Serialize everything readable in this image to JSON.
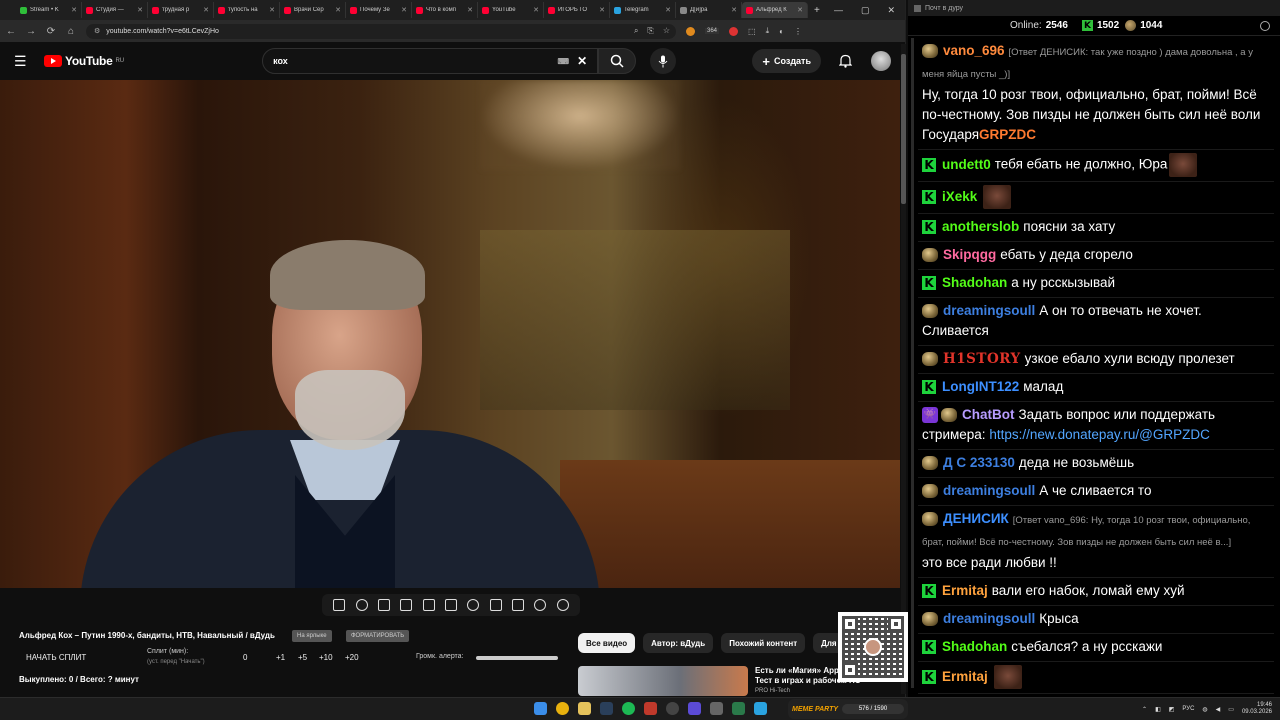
{
  "browser": {
    "tabs": [
      {
        "label": "Stream • K",
        "color": "#2fbf3a"
      },
      {
        "label": "Студия — ",
        "color": "#ff0033"
      },
      {
        "label": "трудная р",
        "color": "#ff0033"
      },
      {
        "label": "тупость на",
        "color": "#ff0033"
      },
      {
        "label": "Врачи Сер",
        "color": "#ff0033"
      },
      {
        "label": "Почему Зе",
        "color": "#ff0033"
      },
      {
        "label": "Что в комп",
        "color": "#ff0033"
      },
      {
        "label": "YouTube",
        "color": "#ff0033"
      },
      {
        "label": "ИГОРЬ ГО",
        "color": "#ff0033"
      },
      {
        "label": "Telegram",
        "color": "#2aa3e0"
      },
      {
        "label": "Д[и]ра",
        "color": "#888888"
      },
      {
        "label": "Альфред К",
        "color": "#ff0033",
        "active": true
      }
    ],
    "new_tab": "+",
    "url": "youtube.com/watch?v=e6tLCevZjHo",
    "ext_count": "364"
  },
  "youtube": {
    "logo_text": "YouTube",
    "logo_region": "RU",
    "search_value": "кох",
    "create_label": "Создать",
    "video_title": "Альфред Кох – Путин 1990-х, бандиты, НТВ, Навальный / вДудь",
    "chip_a": "На ярлыке",
    "chip_b": "ФОРМАТИРОВАТЬ",
    "split": {
      "start_label": "НАЧАТЬ СПЛИТ",
      "split_label": "Сплит (мин):",
      "split_sub": "(уст. перед \"Начать\")",
      "values": [
        "0",
        "+1",
        "+5",
        "+10",
        "+20"
      ],
      "alert_label": "Громк. алерта:",
      "alert_volume": 1.0
    },
    "bought": "Выкуплено: 0 / Всего: ? минут",
    "rec_tabs": [
      "Все видео",
      "Автор: вДудь",
      "Похожий контент",
      "Для в"
    ],
    "rec_item": {
      "title": "Есть ли «Магия» Apple? Тест в играх и рабочем ПО",
      "sub": "PRO Hi-Tech"
    }
  },
  "chat": {
    "window_title": "Почт в дуру",
    "online_label": "Online:",
    "online_count": "2546",
    "kick_count": "1502",
    "twitch_count": "1044",
    "messages": [
      {
        "platform": "twitch",
        "nick": "vano_696",
        "color": "#ff8a3d",
        "reply": "[Ответ ДЕНИСИК: так уже поздно ) дама довольна , а у меня яйца пусты _)]",
        "text": "Ну, тогда 10 розг твои, официально, брат, пойми! Всё по-честному. Зов пизды не должен быть сил неё воли Государя",
        "tail": "GRPZDC"
      },
      {
        "platform": "kick",
        "nick": "undett0",
        "color": "#53fc18",
        "text": "тебя ебать не должно, Юра",
        "emote": true
      },
      {
        "platform": "kick",
        "nick": "iXekk",
        "color": "#53fc18",
        "text": "",
        "emote": true
      },
      {
        "platform": "kick",
        "nick": "anotherslob",
        "color": "#53fc18",
        "text": "поясни за хату"
      },
      {
        "platform": "twitch",
        "nick": "Skipqgg",
        "color": "#ff6aa0",
        "text": "ебать у деда сгорело"
      },
      {
        "platform": "kick",
        "nick": "Shadohan",
        "color": "#53fc18",
        "text": "а ну рсскызывай"
      },
      {
        "platform": "twitch",
        "nick": "dreamingsoull",
        "color": "#3d7fe0",
        "text": "А он то отвечать не хочет. Сливается"
      },
      {
        "platform": "twitch",
        "nick": "H1STORY",
        "color": "#e0342a",
        "text": "узкое ебало хули всюду пролезет",
        "gothic": true
      },
      {
        "platform": "kick",
        "nick": "LongINT122",
        "color": "#3d8fff",
        "text": "малад"
      },
      {
        "platform": "bot",
        "nick": "ChatBot",
        "color": "#b79cff",
        "text": "Задать вопрос или поддержать стримера:",
        "link": "https://new.donatepay.ru/@GRPZDC"
      },
      {
        "platform": "twitch",
        "nick": "Д С 233130",
        "color": "#3d7fe0",
        "text": "деда не возьмёшь"
      },
      {
        "platform": "twitch",
        "nick": "dreamingsoull",
        "color": "#3d7fe0",
        "text": "А че сливается то"
      },
      {
        "platform": "twitch",
        "nick": "ДЕНИСИК",
        "color": "#3d8fff",
        "reply": "[Ответ vano_696: Ну, тогда 10 розг твои, официально, брат, пойми! Всё по-честному. Зов пизды не должен быть сил неё в...]",
        "text": "это все ради любви !!"
      },
      {
        "platform": "kick",
        "nick": "Ermitaj",
        "color": "#ffa23d",
        "text": "вали его набок, ломай ему хуй"
      },
      {
        "platform": "twitch",
        "nick": "dreamingsoull",
        "color": "#3d7fe0",
        "text": "Крыса"
      },
      {
        "platform": "kick",
        "nick": "Shadohan",
        "color": "#53fc18",
        "text": "съебался? а ну рсскажи"
      },
      {
        "platform": "kick",
        "nick": "Ermitaj",
        "color": "#ffa23d",
        "text": "",
        "emote": true
      }
    ]
  },
  "taskbar": {
    "meme_label": "MEME PARTY",
    "meme_progress": "576 / 1590",
    "lang": "РУС",
    "time": "19:46",
    "date": "09.03.2026"
  }
}
